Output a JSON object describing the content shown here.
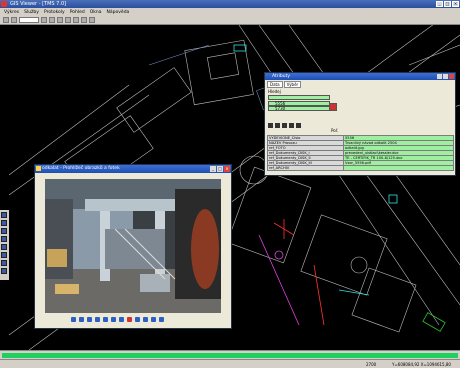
{
  "app": {
    "title": "GIS Viewer - [TMS 7.0]",
    "window_buttons": [
      "_",
      "□",
      "×"
    ]
  },
  "menu": [
    "Výkres",
    "Služby",
    "Protokoly",
    "Pohled",
    "Okna",
    "Nápověda"
  ],
  "status": {
    "zoom": "2700",
    "coords": "Y=608084,92 X=1094615,80"
  },
  "colors": {
    "canvas": "#000000",
    "cad_lines": "#c8c8c8",
    "accent_green": "#1fd05f",
    "highlight_red": "#ff3030",
    "magenta": "#e040e0",
    "cyan": "#30e0e0"
  },
  "photo_window": {
    "title": "odkalat - Prohlížeč obrazků a fotek",
    "buttons": [
      "_",
      "□",
      "×"
    ],
    "toolbar_icons": [
      "prev-icon",
      "next-icon",
      "refresh-icon",
      "zoom-in-icon",
      "zoom-out-icon",
      "rotate-left-icon",
      "rotate-right-icon",
      "delete-icon",
      "copy-icon",
      "save-icon",
      "print-icon",
      "info-icon"
    ]
  },
  "prop_window": {
    "title": "Atributy",
    "tabs": [
      "Data",
      "Výběr"
    ],
    "field_label": "Hledej",
    "list": [
      "5556",
      "5730"
    ],
    "sort_label": "Poř.",
    "rows": [
      {
        "k": "VYDEVIONE_Číslo",
        "v": "5556"
      },
      {
        "k": "NÁZEV Provozu",
        "v": "Trvanlivý návod odkalit 2504"
      },
      {
        "k": "ref_FOTO",
        "v": "odkalit.jpg"
      },
      {
        "k": "ref_Dokumenty_DISK_I",
        "v": "prevedeni_ulstlaci\\kessler.doc"
      },
      {
        "k": "ref_Dokumenty_DISK_II",
        "v": "TE - CERTIFIK_TR 100-8/125.doc"
      },
      {
        "k": "ref_Dokumenty_DISK_III",
        "v": "Vzor_5556.pdf"
      },
      {
        "k": "ref_ARCHIV",
        "v": ""
      }
    ]
  }
}
